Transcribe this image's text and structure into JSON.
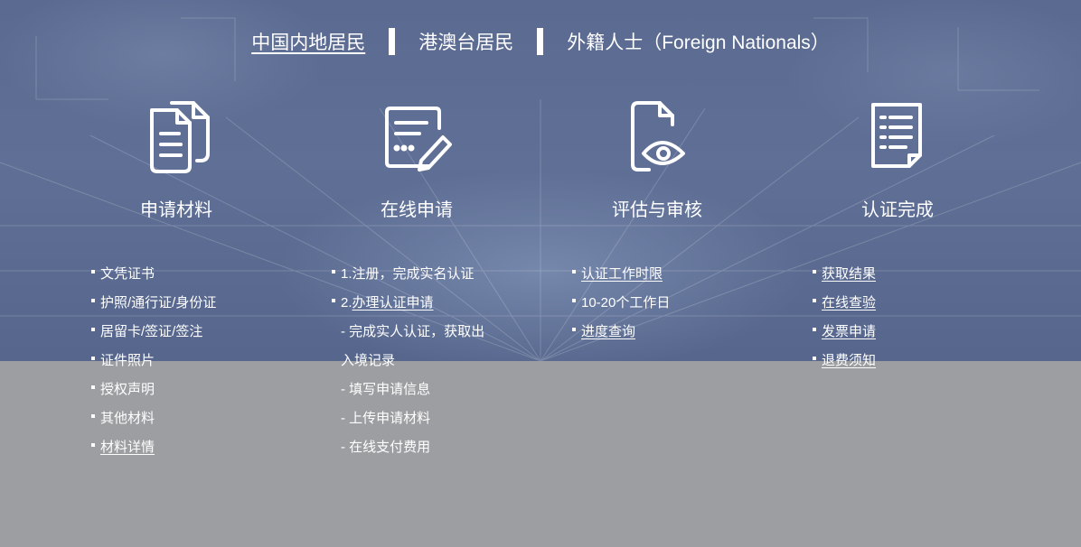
{
  "tabs": [
    {
      "label": "中国内地居民",
      "active": true
    },
    {
      "label": "港澳台居民",
      "active": false
    },
    {
      "label": "外籍人士（Foreign Nationals）",
      "active": false
    }
  ],
  "steps": [
    {
      "title": "申请材料",
      "icon": "documents-icon"
    },
    {
      "title": "在线申请",
      "icon": "form-edit-icon"
    },
    {
      "title": "评估与审核",
      "icon": "document-review-icon"
    },
    {
      "title": "认证完成",
      "icon": "checklist-icon"
    }
  ],
  "columns": {
    "materials": [
      "文凭证书",
      "护照/通行证/身份证",
      "居留卡/签证/签注",
      "证件照片",
      "授权声明",
      "其他材料",
      "材料详情"
    ],
    "online": {
      "item1": "1.注册，完成实名认证",
      "item2_prefix": "2.",
      "item2_link": "办理认证申请",
      "sub": [
        "- 完成实人认证，获取出",
        "入境记录",
        "- 填写申请信息",
        "- 上传申请材料",
        "- 在线支付费用"
      ]
    },
    "review": [
      "认证工作时限",
      "10-20个工作日",
      "进度查询"
    ],
    "complete": [
      "获取结果",
      "在线查验",
      "发票申请",
      "退费须知"
    ]
  },
  "colors": {
    "hero_bg": "#5c6c92",
    "page_bg": "#9d9ea2",
    "text": "#ffffff"
  }
}
